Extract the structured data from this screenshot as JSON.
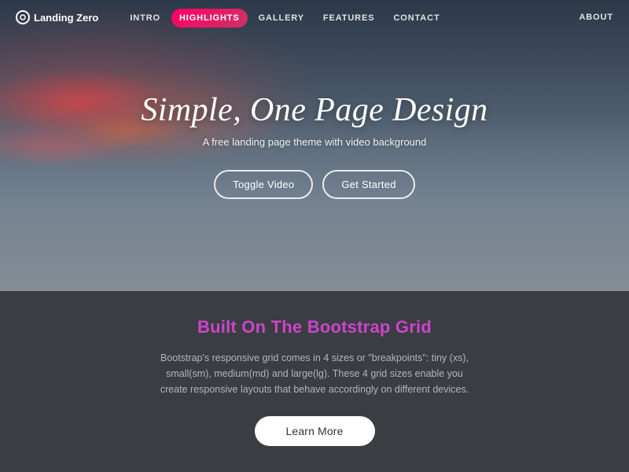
{
  "nav": {
    "logo": "Landing Zero",
    "links": [
      {
        "label": "INTRO",
        "active": false
      },
      {
        "label": "HIGHLIGHTS",
        "active": true
      },
      {
        "label": "GALLERY",
        "active": false
      },
      {
        "label": "FEATURES",
        "active": false
      },
      {
        "label": "CONTACT",
        "active": false
      }
    ],
    "about": "ABOUT"
  },
  "hero": {
    "title": "Simple, One Page Design",
    "subtitle": "A free landing page theme with video background",
    "toggle_video": "Toggle Video",
    "get_started": "Get Started"
  },
  "bottom": {
    "title": "Built On The Bootstrap Grid",
    "description": "Bootstrap's responsive grid comes in 4 sizes or \"breakpoints\": tiny (xs), small(sm), medium(md) and large(lg). These 4 grid sizes enable you create responsive layouts that behave accordingly on different devices.",
    "learn_more": "Learn More"
  }
}
